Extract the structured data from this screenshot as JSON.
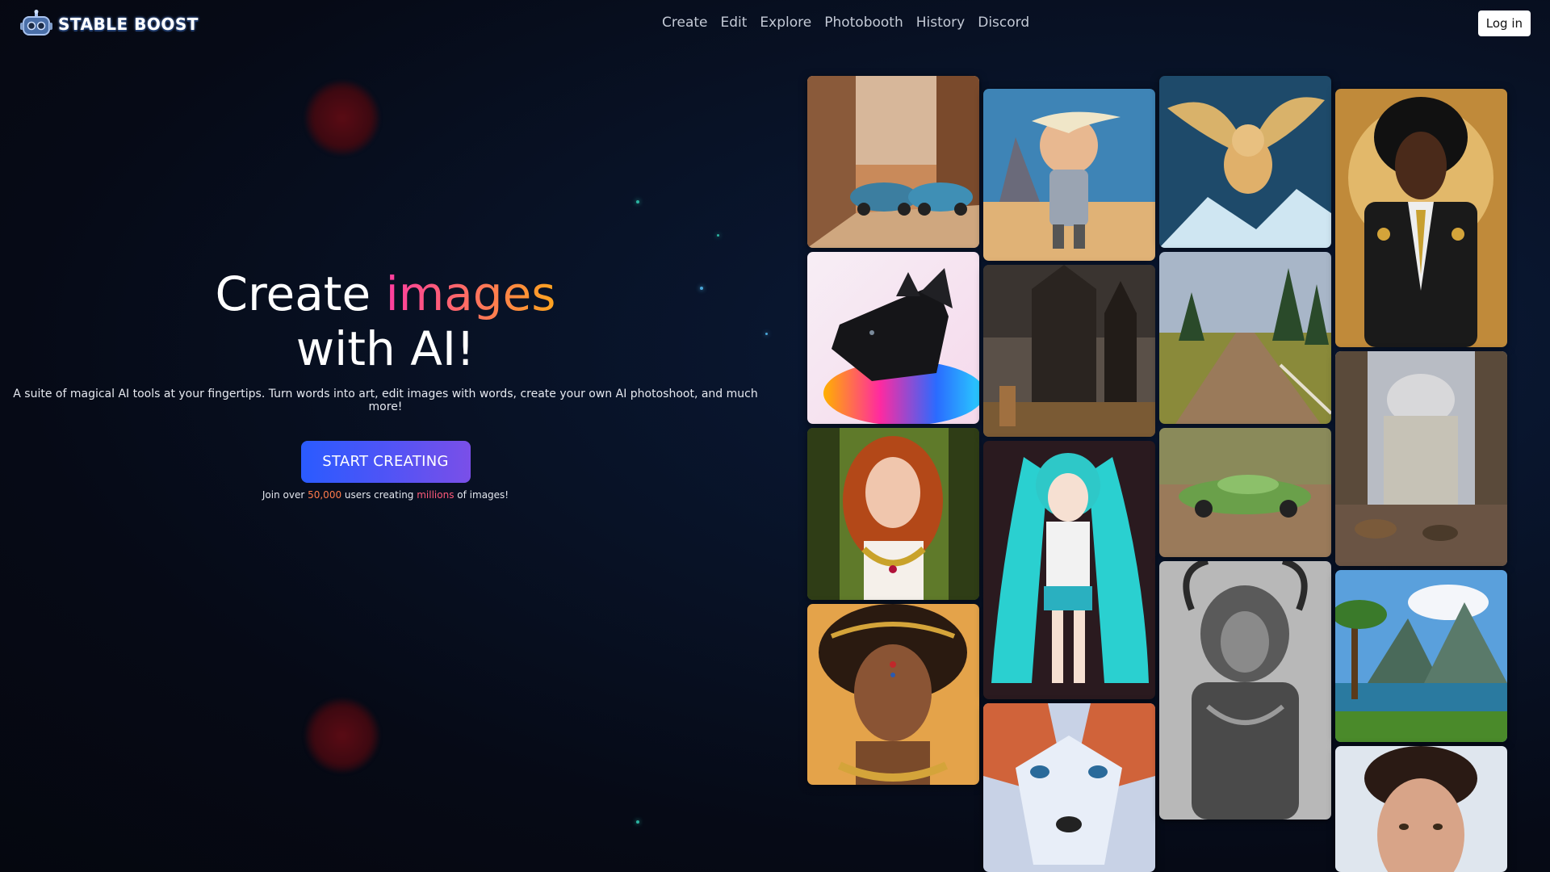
{
  "brand": {
    "name": "STABLE BOOST",
    "icon": "robot-icon"
  },
  "nav": [
    "Create",
    "Edit",
    "Explore",
    "Photobooth",
    "History",
    "Discord"
  ],
  "login_label": "Log in",
  "hero": {
    "title_prefix": "Create ",
    "title_highlight": "images",
    "title_line2": "with AI!",
    "subtitle": "A suite of magical AI tools at your fingertips. Turn words into art, edit images with words, create your own AI photoshoot, and much more!",
    "cta_label": "START CREATING",
    "join_prefix": "Join over ",
    "join_users": "50,000",
    "join_middle": " users creating ",
    "join_millions": "millions",
    "join_suffix": " of images!"
  },
  "colors": {
    "accent_gradient_start": "#ff3da1",
    "accent_gradient_end": "#ffa51e",
    "cta_start": "#2a5bff",
    "cta_end": "#7a4fe8"
  },
  "gallery": [
    {
      "subject": "vintage cars in sunny street"
    },
    {
      "subject": "black dog with colorful smoke"
    },
    {
      "subject": "red-haired woman in forest"
    },
    {
      "subject": "african queen with gold jewelry"
    },
    {
      "subject": "cartoon boy in spacesuit"
    },
    {
      "subject": "dark gothic castle"
    },
    {
      "subject": "anime girl with teal twin tails"
    },
    {
      "subject": "fox close-up"
    },
    {
      "subject": "flying golden dog"
    },
    {
      "subject": "countryside road with pine trees"
    },
    {
      "subject": "green classic sports car"
    },
    {
      "subject": "armored lion warrior in grayscale"
    },
    {
      "subject": "man in ornate golden suit"
    },
    {
      "subject": "ruined domed capitol building"
    },
    {
      "subject": "lake valley landscape"
    },
    {
      "subject": "smiling woman portrait"
    }
  ]
}
